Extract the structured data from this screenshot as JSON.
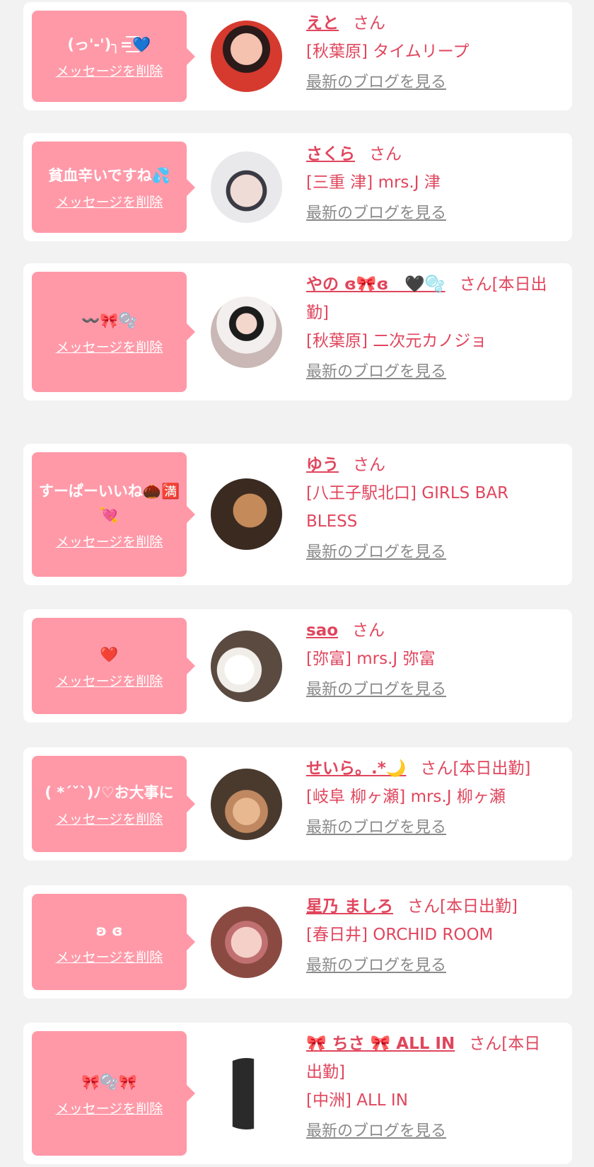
{
  "entries": [
    {
      "message": "(っ'-')╮=͟͟͞͞💙",
      "delete_label": "メッセージを削除",
      "name": "えと",
      "suffix": "さん",
      "shop": "[秋葉原] タイムリープ",
      "blog_label": "最新のブログを見る",
      "avatar_colors": [
        "#d63a2e",
        "#f5c2b0"
      ]
    },
    {
      "message": "貧血辛いですね💦",
      "delete_label": "メッセージを削除",
      "name": "さくら",
      "suffix": "さん",
      "shop": "[三重 津] mrs.J 津",
      "blog_label": "最新のブログを見る",
      "avatar_colors": [
        "#9aa0a8",
        "#e9e9ec"
      ]
    },
    {
      "message": "〰️🎀🫧",
      "delete_label": "メッセージを削除",
      "name": "やの ɞ🎀ɞ　🖤🫧",
      "suffix": "さん[本日出勤]",
      "shop": "[秋葉原] 二次元カノジョ",
      "blog_label": "最新のブログを見る",
      "avatar_colors": [
        "#f2efee",
        "#c9b8b5"
      ]
    },
    {
      "message": "すーぱーいいね🌰🈵💘",
      "delete_label": "メッセージを削除",
      "name": "ゆう",
      "suffix": "さん",
      "shop": "[八王子駅北口] GIRLS BAR BLESS",
      "blog_label": "最新のブログを見る",
      "avatar_colors": [
        "#3a2a20",
        "#c48a5a"
      ]
    },
    {
      "message": "❤️",
      "delete_label": "メッセージを削除",
      "name": "sao",
      "suffix": "さん",
      "shop": "[弥富] mrs.J 弥富",
      "blog_label": "最新のブログを見る",
      "avatar_colors": [
        "#5a4a40",
        "#f1eeea"
      ]
    },
    {
      "message": "( *´ˇ`)ﾉ♡お大事に",
      "delete_label": "メッセージを削除",
      "name": "せいら。.*🌙",
      "suffix": "さん[本日出勤]",
      "shop": "[岐阜 柳ヶ瀬] mrs.J 柳ヶ瀬",
      "blog_label": "最新のブログを見る",
      "avatar_colors": [
        "#4a3a2e",
        "#d9a77c"
      ]
    },
    {
      "message": "ʚ ɞ",
      "delete_label": "メッセージを削除",
      "name": "星乃 ましろ",
      "suffix": "さん[本日出勤]",
      "shop": "[春日井] ORCHID ROOM",
      "blog_label": "最新のブログを見る",
      "avatar_colors": [
        "#8a4a42",
        "#f0c0b8"
      ]
    },
    {
      "message": "🎀🫧🎀",
      "delete_label": "メッセージを削除",
      "name": "🎀 ちさ 🎀 ALL IN",
      "suffix": "さん[本日出勤]",
      "shop": "[中洲] ALL IN",
      "blog_label": "最新のブログを見る",
      "avatar_colors": [
        "#ffffff",
        "#2a2a2a"
      ]
    }
  ]
}
